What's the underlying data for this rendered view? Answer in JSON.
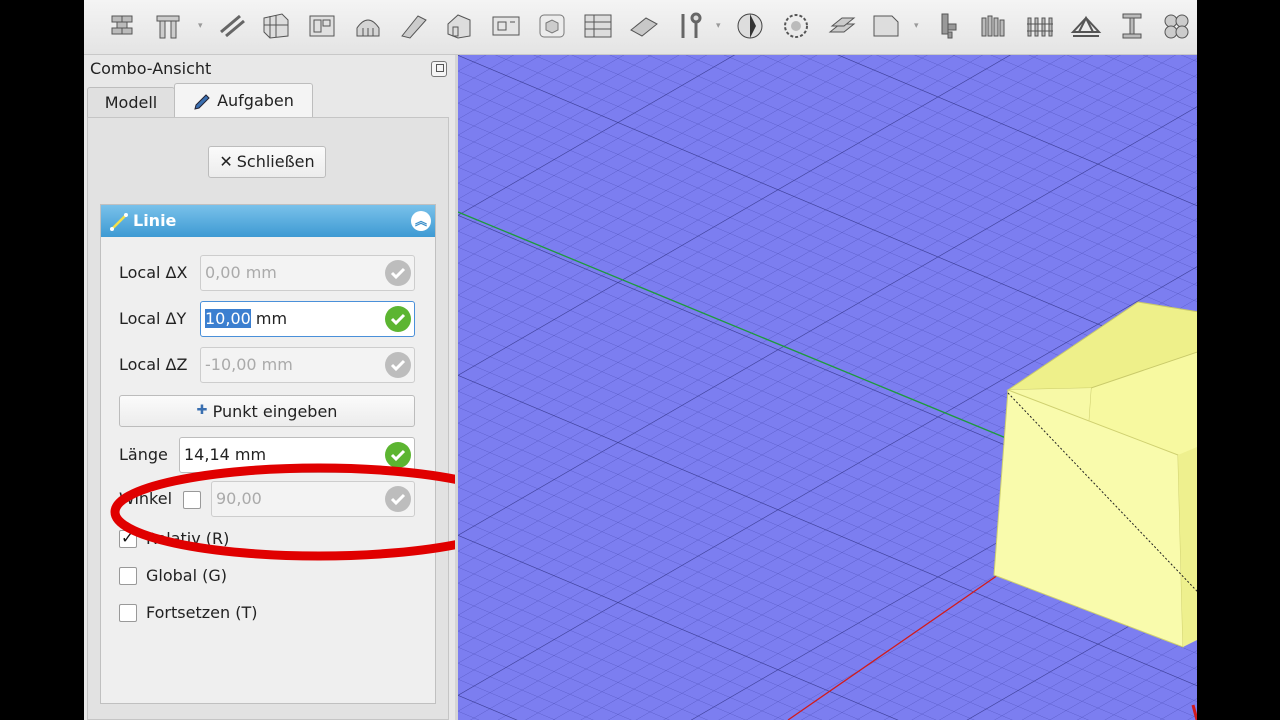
{
  "toolbar": {
    "icons": [
      "wall-icon",
      "structure-icon",
      "rebar-icon",
      "curtainwall-icon",
      "window-icon",
      "dome-icon",
      "stairs-icon",
      "building-icon",
      "panel-icon",
      "equipment-icon",
      "frame-icon",
      "roof-icon",
      "pipe-icon",
      "axis-icon",
      "space-icon",
      "cut-plane-icon",
      "stairs2-icon",
      "material-icon",
      "column-icon",
      "section-icon",
      "fence-icon",
      "truss-icon",
      "profile-icon",
      "components-icon"
    ]
  },
  "combo": {
    "title": "Combo-Ansicht",
    "tabs": {
      "modell": "Modell",
      "aufgaben": "Aufgaben"
    },
    "close_label": "Schließen"
  },
  "line": {
    "header": "Linie",
    "dx_label": "Local ΔX",
    "dx_value": "0,00 mm",
    "dy_label": "Local ΔY",
    "dy_value_selected": "10,00",
    "dy_unit": " mm",
    "dz_label": "Local ΔZ",
    "dz_value": "-10,00 mm",
    "point_button": "Punkt eingeben",
    "length_label": "Länge",
    "length_value": "14,14 mm",
    "angle_label": "Winkel",
    "angle_value": "90,00",
    "relative_label": "Relativ (R)",
    "global_label": "Global (G)",
    "continue_label": "Fortsetzen (T)"
  },
  "colors": {
    "viewport_bg": "#7c7ef0",
    "accent_header": "#3e9ad3",
    "check_on": "#5cb531",
    "annotation": "#e00000",
    "box_face": "#f7f9a0"
  }
}
